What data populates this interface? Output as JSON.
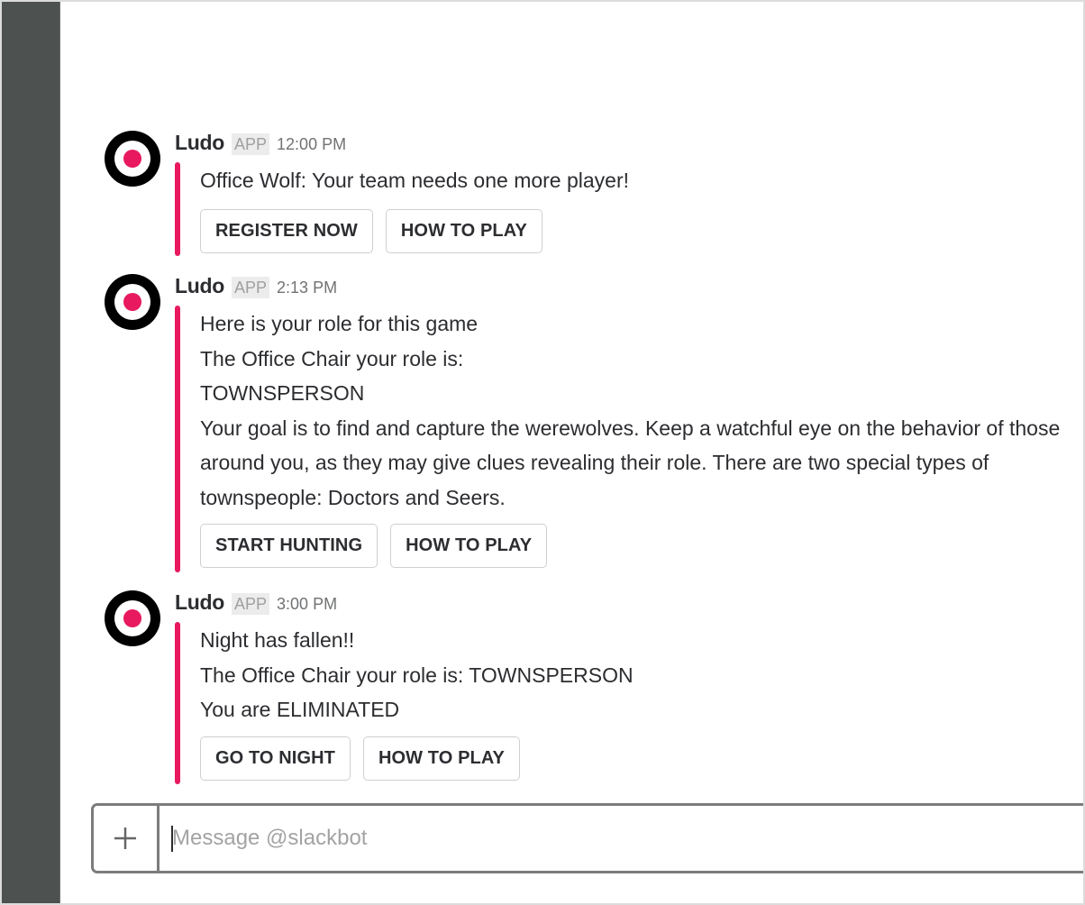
{
  "colors": {
    "sidebar": "#4d5250",
    "accent": "#e8195e",
    "avatar_outer": "#000000",
    "avatar_inner": "#e8195e"
  },
  "messages": [
    {
      "sender": "Ludo",
      "badge": "APP",
      "time": "12:00 PM",
      "avatar_icon": "target-logo-icon",
      "lines": [
        "Office Wolf: Your team needs one more player!"
      ],
      "actions": [
        {
          "label": "REGISTER NOW"
        },
        {
          "label": "HOW TO PLAY"
        }
      ]
    },
    {
      "sender": "Ludo",
      "badge": "APP",
      "time": "2:13 PM",
      "avatar_icon": "target-logo-icon",
      "lines": [
        "Here is your role for this game",
        "The Office Chair your role is:",
        "TOWNSPERSON"
      ],
      "paragraph": "Your goal is to find and capture the werewolves. Keep a watchful eye on the behavior of those around you, as they may give clues revealing their role. There are two special types of townspeople: Doctors and Seers.",
      "actions": [
        {
          "label": "START HUNTING"
        },
        {
          "label": "HOW TO PLAY"
        }
      ]
    },
    {
      "sender": "Ludo",
      "badge": "APP",
      "time": "3:00 PM",
      "avatar_icon": "target-logo-icon",
      "lines": [
        "Night has fallen!!",
        "The Office Chair your role is: TOWNSPERSON",
        "You are ELIMINATED"
      ],
      "actions": [
        {
          "label": "GO TO NIGHT"
        },
        {
          "label": "HOW TO PLAY"
        }
      ]
    }
  ],
  "composer": {
    "plus_icon": "plus-icon",
    "placeholder": "Message @slackbot",
    "value": ""
  }
}
